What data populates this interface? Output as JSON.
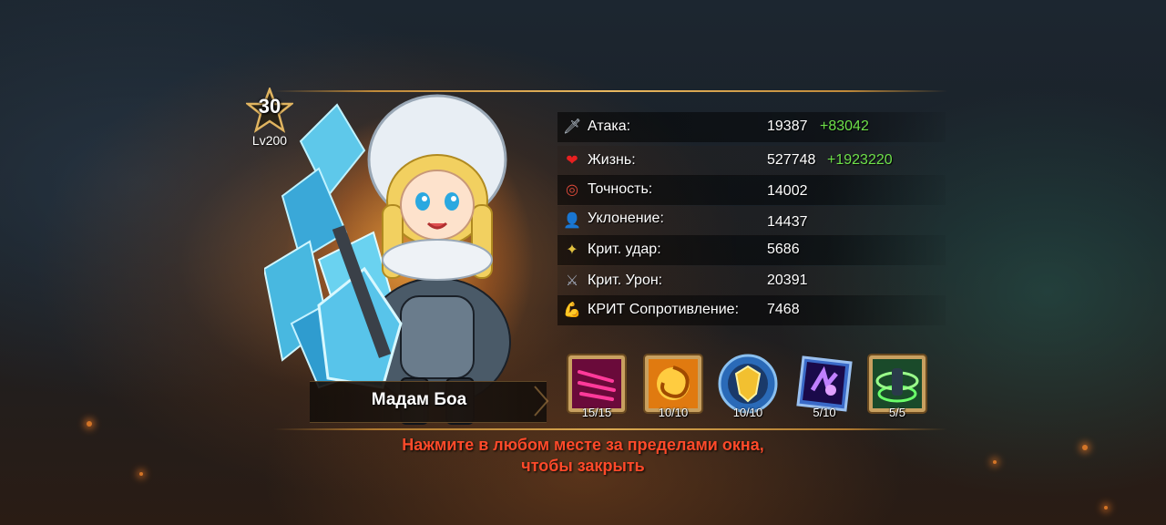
{
  "hero": {
    "stars": "30",
    "level": "Lv200",
    "name": "Мадам Боа"
  },
  "stats": [
    {
      "icon": "sword-icon",
      "label": "Атака:",
      "value": "19387",
      "bonus": "+83042"
    },
    {
      "icon": "heart-icon",
      "label": "Жизнь:",
      "value": "527748",
      "bonus": "+1923220"
    },
    {
      "icon": "target-icon",
      "label": "Точность:",
      "value": "14002",
      "bonus": ""
    },
    {
      "icon": "dodge-icon",
      "label": "Уклонение:",
      "value": "14437",
      "bonus": ""
    },
    {
      "icon": "crit-strike-icon",
      "label": "Крит. удар:",
      "value": "5686",
      "bonus": ""
    },
    {
      "icon": "crit-damage-icon",
      "label": "Крит. Урон:",
      "value": "20391",
      "bonus": ""
    },
    {
      "icon": "crit-resist-icon",
      "label": "КРИТ Сопротивление:",
      "value": "7468",
      "bonus": ""
    }
  ],
  "skills": [
    {
      "icon": "claw-skill-icon",
      "level": "15/15"
    },
    {
      "icon": "vortex-skill-icon",
      "level": "10/10"
    },
    {
      "icon": "golden-shield-skill-icon",
      "level": "10/10"
    },
    {
      "icon": "purple-burst-skill-icon",
      "level": "5/10"
    },
    {
      "icon": "green-aura-skill-icon",
      "level": "5/5"
    }
  ],
  "close_hint_line1": "Нажмите в любом месте за пределами окна,",
  "close_hint_line2": "чтобы закрыть",
  "colors": {
    "bonus": "#6ee04a",
    "hint": "#ff4a2a",
    "accent_gold": "#e8b860"
  }
}
